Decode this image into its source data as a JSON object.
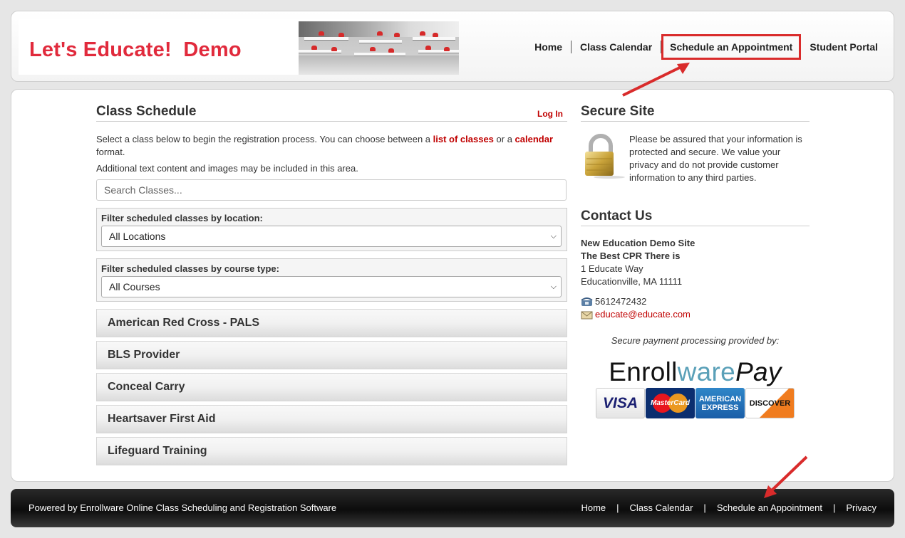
{
  "header": {
    "banner_text": "Let's Educate!  Demo",
    "nav": [
      "Home",
      "Class Calendar",
      "Schedule an Appointment",
      "Student Portal"
    ]
  },
  "schedule": {
    "title": "Class Schedule",
    "login": "Log In",
    "intro_before": "Select a class below to begin the registration process.  You can choose between a ",
    "list_link": "list of classes",
    "intro_mid": " or a ",
    "calendar_link": "calendar",
    "intro_after": " format.",
    "additional": "Additional text content and images may be included in this area.",
    "search_placeholder": "Search Classes...",
    "filter_location_label": "Filter scheduled classes by location:",
    "filter_location_value": "All Locations",
    "filter_course_label": "Filter scheduled classes by course type:",
    "filter_course_value": "All Courses",
    "courses": [
      "American Red Cross - PALS",
      "BLS Provider",
      "Conceal Carry",
      "Heartsaver First Aid",
      "Lifeguard Training"
    ]
  },
  "secure": {
    "title": "Secure Site",
    "text": "Please be assured that your information is protected and secure. We value your privacy and do not provide customer information to any third parties."
  },
  "contact": {
    "title": "Contact Us",
    "name": "New Education Demo Site",
    "tagline": "The Best CPR There is",
    "address1": "1 Educate Way",
    "address2": "Educationville, MA 11111",
    "phone": "5612472432",
    "email": "educate@educate.com",
    "payment_note": "Secure payment processing provided by:",
    "pay_brand_1": "Enroll",
    "pay_brand_2": "ware",
    "pay_brand_3": "Pay",
    "cards": {
      "visa": "VISA",
      "mc": "MasterCard",
      "amex_1": "AMERICAN",
      "amex_2": "EXPRESS",
      "discover": "DISCOVER"
    }
  },
  "footer": {
    "powered": "Powered by Enrollware Online Class Scheduling and Registration Software",
    "nav": [
      "Home",
      "Class Calendar",
      "Schedule an Appointment",
      "Privacy"
    ],
    "separator": "|"
  },
  "colors": {
    "accent_red": "#c00000",
    "highlight_red": "#d92b2b",
    "banner_red": "#e12a3c"
  }
}
